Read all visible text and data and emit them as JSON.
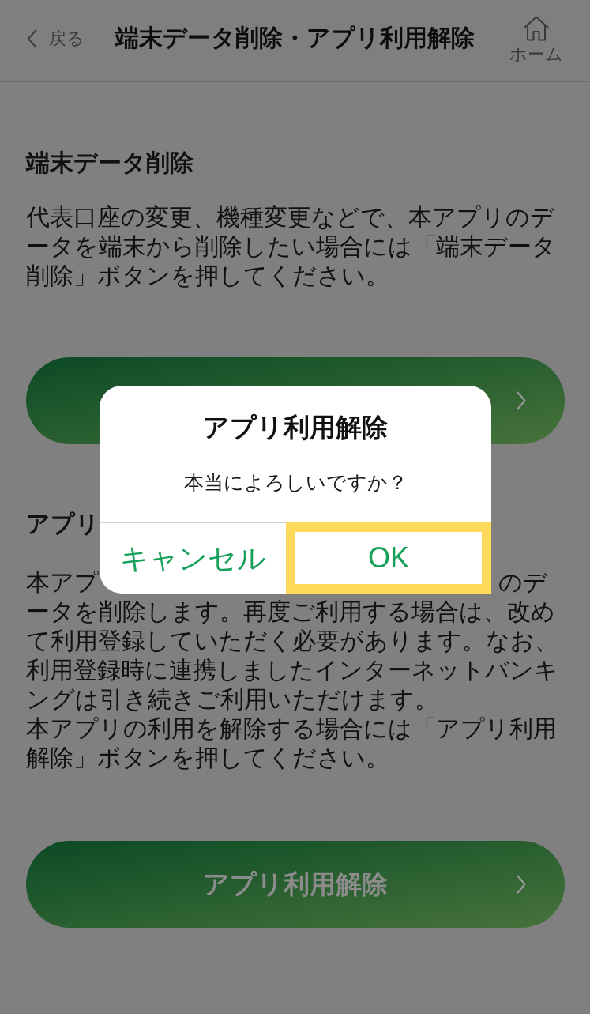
{
  "page": {
    "dimmed": true
  },
  "header": {
    "back_label": "戻る",
    "title": "端末データ削除・アプリ利用解除",
    "home_label": "ホーム"
  },
  "sections": [
    {
      "heading": "端末データ削除",
      "paragraphs": [
        "代表口座の変更、機種変更などで、本アプリのデータを端末から削除したい場合には「端末データ削除」ボタンを押してください。"
      ],
      "button": {
        "kind": "pill"
      }
    },
    {
      "heading": "アプリ",
      "covered_line": [
        "本アプ",
        "のデ"
      ],
      "paragraphs": [
        "ータを削除します。再度ご利用する場合は、改めて利用登録していただく必要があります。なお、利用登録時に連携しましたインターネットバンキングは引き続きご利用いただけます。",
        "本アプリの利用を解除する場合には「アプリ利用解除」ボタンを押してください。"
      ],
      "button": {
        "kind": "pill",
        "label": "アプリ利用解除"
      }
    }
  ],
  "dialog": {
    "title": "アプリ利用解除",
    "message": "本当によろしいですか？",
    "buttons": [
      {
        "label": "キャンセル",
        "highlighted": false
      },
      {
        "label": "OK",
        "highlighted": true
      }
    ]
  }
}
